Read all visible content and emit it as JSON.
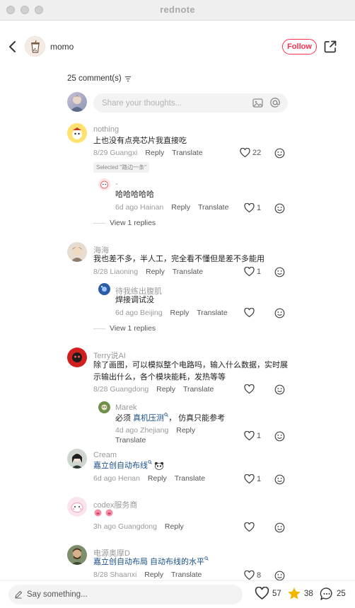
{
  "window": {
    "title": "rednote"
  },
  "header": {
    "author_name": "momo",
    "follow_label": "Follow"
  },
  "comments_header": {
    "count_label": "25 comment(s)"
  },
  "composer": {
    "placeholder": "Share your thoughts..."
  },
  "comments": [
    {
      "username": "nothing",
      "text": "上也没有点亮芯片我直接吃",
      "date": "8/29",
      "location": "Guangxi",
      "reply_label": "Reply",
      "translate_label": "Translate",
      "likes": "22",
      "tag": "Selected \"路边一条\""
    },
    {
      "username": "-",
      "text": "哈哈哈哈哈",
      "date": "6d ago",
      "location": "Hainan",
      "reply_label": "Reply",
      "translate_label": "Translate",
      "likes": "1"
    },
    {
      "view_replies": "View 1 replies"
    },
    {
      "username": "海海",
      "text": "我也差不多，半人工，完全看不懂但是差不多能用",
      "date": "8/28",
      "location": "Liaoning",
      "reply_label": "Reply",
      "translate_label": "Translate",
      "likes": "1"
    },
    {
      "username": "待我练出腹肌",
      "text": "焊接调试没",
      "date": "6d ago",
      "location": "Beijing",
      "reply_label": "Reply",
      "translate_label": "Translate",
      "likes": ""
    },
    {
      "view_replies": "View 1 replies"
    },
    {
      "username": "Terry说AI",
      "text_line1": "除了画图，可以模拟整个电路吗，输入什么数据，实时展",
      "text_line2": "示输出什么，各个模块能耗，发热等等",
      "date": "8/28",
      "location": "Guangdong",
      "reply_label": "Reply",
      "translate_label": "Translate",
      "likes": ""
    },
    {
      "username": "Marek",
      "text_pre": "必须 ",
      "text_link": "真机压测",
      "text_post": "， 仿真只能参考",
      "date": "4d ago",
      "location": "Zhejiang",
      "reply_label": "Reply",
      "translate_label": "Translate",
      "likes": "1"
    },
    {
      "username": "Cream",
      "text_link": "嘉立创自动布线",
      "date": "6d ago",
      "location": "Henan",
      "reply_label": "Reply",
      "translate_label": "Translate",
      "likes": "1"
    },
    {
      "username": "codex服务商",
      "date": "3h ago",
      "location": "Guangdong",
      "reply_label": "Reply",
      "likes": ""
    },
    {
      "username": "电源奥摩D",
      "text_link": "嘉立创自动布局 自动布线的水平",
      "date": "8/28",
      "location": "Shaanxi",
      "reply_label": "Reply",
      "translate_label": "Translate",
      "likes": "8"
    }
  ],
  "bottombar": {
    "say_placeholder": "Say something...",
    "likes": "57",
    "stars": "38",
    "comments": "25"
  },
  "colors": {
    "accent": "#ff2e4d",
    "link": "#1a4f8a",
    "star": "#f6b400"
  }
}
